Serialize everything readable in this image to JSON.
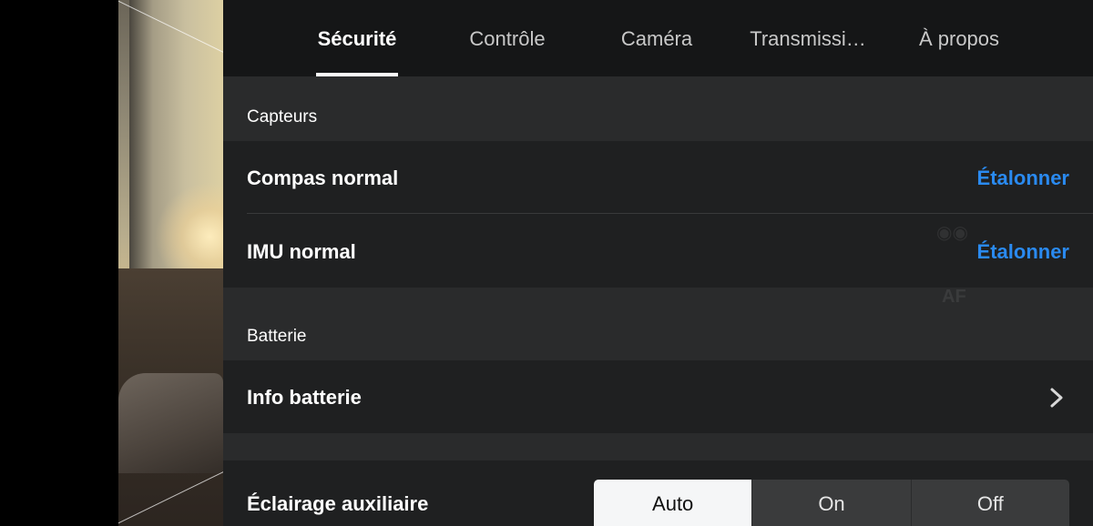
{
  "tabs": [
    {
      "label": "Sécurité",
      "active": true
    },
    {
      "label": "Contrôle",
      "active": false
    },
    {
      "label": "Caméra",
      "active": false
    },
    {
      "label": "Transmissi…",
      "active": false
    },
    {
      "label": "À propos",
      "active": false
    }
  ],
  "sensors": {
    "header": "Capteurs",
    "compass": {
      "label": "Compas normal",
      "action": "Étalonner"
    },
    "imu": {
      "label": "IMU normal",
      "action": "Étalonner"
    }
  },
  "battery": {
    "header": "Batterie",
    "info": {
      "label": "Info batterie"
    }
  },
  "aux_light": {
    "label": "Éclairage auxiliaire",
    "options": [
      "Auto",
      "On",
      "Off"
    ],
    "selected": "Auto"
  },
  "background_hint": {
    "af": "AF"
  },
  "colors": {
    "accent": "#2a8af0",
    "panel": "#1f2021",
    "tab_bar": "#151617",
    "section": "#2a2b2c"
  },
  "icons": {
    "chevron": "chevron-right-icon",
    "binoculars": "binoculars-icon"
  }
}
